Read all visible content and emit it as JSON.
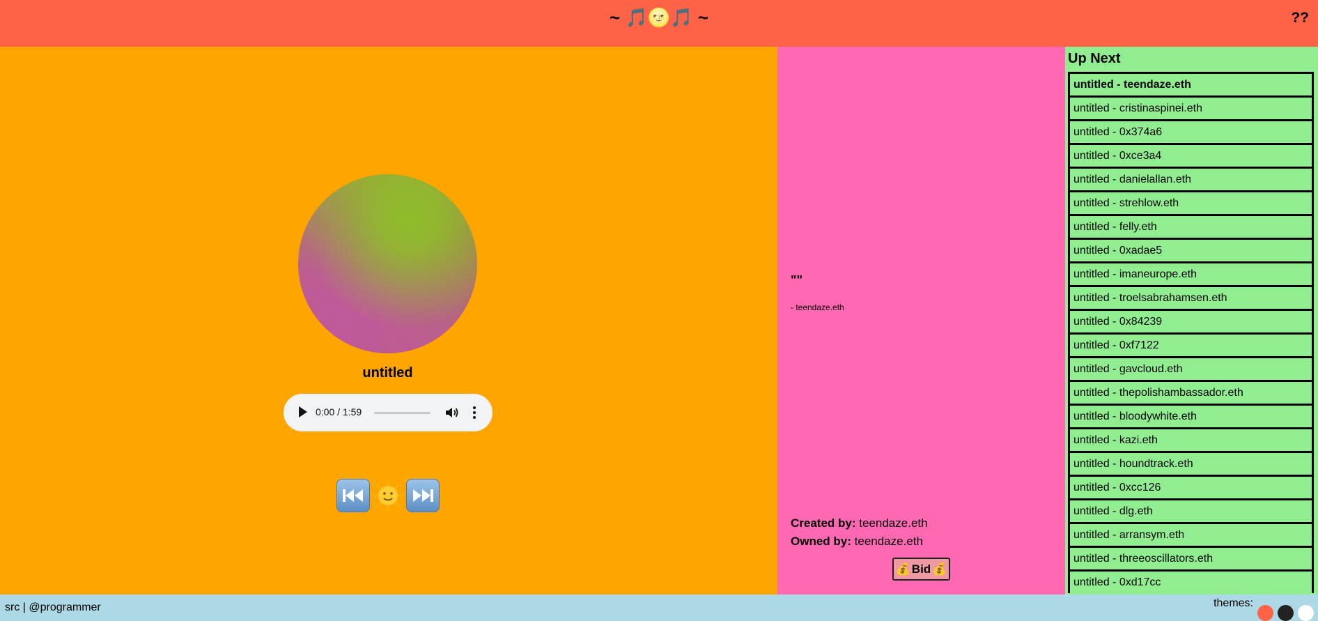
{
  "header": {
    "title": "~ 🎵🌝🎵 ~",
    "help_label": "??"
  },
  "player": {
    "track_title": "untitled",
    "audio": {
      "time": "0:00 / 1:59",
      "progress": 0.0
    },
    "controls": {
      "previous_icon": "previous-track-icon",
      "sun_glyph": "🌞",
      "next_icon": "next-track-icon"
    },
    "colors": {
      "orb_green": "#8fbe2a",
      "orb_pink": "#c0599b"
    }
  },
  "info": {
    "quote": "\"\"",
    "quote_author": "- teendaze.eth",
    "created_by_label": "Created by:",
    "created_by": "teendaze.eth",
    "owned_by_label": "Owned by:",
    "owned_by": "teendaze.eth",
    "bid_label": "Bid",
    "bid_icon": "💰"
  },
  "queue": {
    "heading": "Up Next",
    "items": [
      "untitled - teendaze.eth",
      "untitled - cristinaspinei.eth",
      "untitled - 0x374a6",
      "untitled - 0xce3a4",
      "untitled - danielallan.eth",
      "untitled - strehlow.eth",
      "untitled - felly.eth",
      "untitled - 0xadae5",
      "untitled - imaneurope.eth",
      "untitled - troelsabrahamsen.eth",
      "untitled - 0x84239",
      "untitled - 0xf7122",
      "untitled - gavcloud.eth",
      "untitled - thepolishambassador.eth",
      "untitled - bloodywhite.eth",
      "untitled - kazi.eth",
      "untitled - houndtrack.eth",
      "untitled - 0xcc126",
      "untitled - dlg.eth",
      "untitled - arransym.eth",
      "untitled - threeoscillators.eth",
      "untitled - 0xd17cc"
    ],
    "active_index": 0
  },
  "footer": {
    "src_link": "src",
    "separator": " | ",
    "author_link": "@programmer",
    "themes_label": "themes:",
    "themes": [
      {
        "name": "tomato",
        "color": "#ff6347"
      },
      {
        "name": "dark",
        "color": "#222222"
      },
      {
        "name": "light",
        "color": "#ffffff"
      }
    ]
  },
  "colors": {
    "header_bg": "#ff6347",
    "player_bg": "#ffa500",
    "info_bg": "#ff69b4",
    "queue_bg": "#90ee90",
    "footer_bg": "#add8e6"
  }
}
